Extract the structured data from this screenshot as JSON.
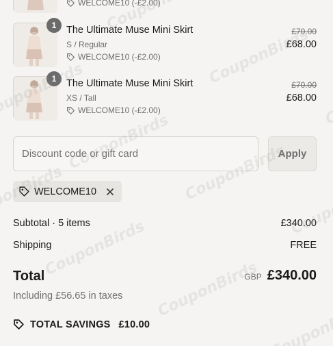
{
  "items": [
    {
      "title": "",
      "variant": "",
      "discount": "WELCOME10 (-£2.00)",
      "quantity": "",
      "original_price": "",
      "price": ""
    },
    {
      "title": "The Ultimate Muse Mini Skirt",
      "variant": "S / Regular",
      "discount": "WELCOME10 (-£2.00)",
      "quantity": "1",
      "original_price": "£70.00",
      "price": "£68.00"
    },
    {
      "title": "The Ultimate Muse Mini Skirt",
      "variant": "XS / Tall",
      "discount": "WELCOME10 (-£2.00)",
      "quantity": "1",
      "original_price": "£70.00",
      "price": "£68.00"
    }
  ],
  "discount_field": {
    "placeholder": "Discount code or gift card",
    "value": "",
    "apply_label": "Apply"
  },
  "applied_code": {
    "code": "WELCOME10"
  },
  "summary": {
    "subtotal_label": "Subtotal · 5 items",
    "subtotal_value": "£340.00",
    "shipping_label": "Shipping",
    "shipping_value": "FREE",
    "total_label": "Total",
    "currency": "GBP",
    "total_value": "£340.00",
    "taxes_note": "Including £56.65 in taxes",
    "savings_label": "TOTAL SAVINGS",
    "savings_value": "£10.00"
  },
  "watermark": "CouponBirds",
  "icons": {
    "discount": "tag-icon",
    "remove": "close-icon",
    "savings": "tag-icon"
  }
}
